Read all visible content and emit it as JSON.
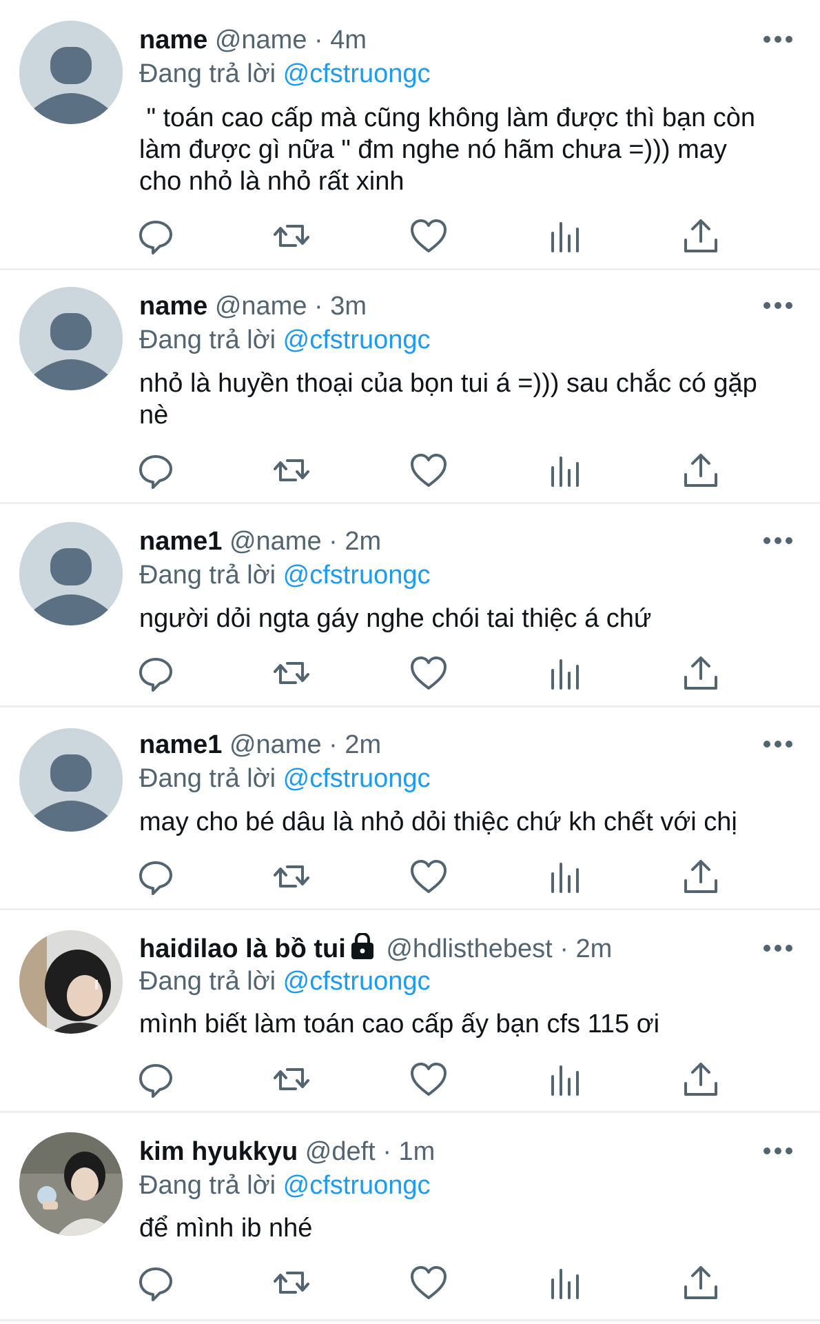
{
  "reply_prefix": "Đang trả lời",
  "tweets": [
    {
      "name": "name",
      "handle": "@name",
      "sep": "·",
      "time": "4m",
      "reply_to": "@cfstruongc",
      "text": " \" toán cao cấp mà cũng không làm được thì bạn còn\nlàm được gì nữa \" đm nghe nó hãm chưa =))) may\ncho nhỏ là nhỏ rất xinh",
      "avatar": "default-avatar",
      "protected": false
    },
    {
      "name": "name",
      "handle": "@name",
      "sep": "·",
      "time": "3m",
      "reply_to": "@cfstruongc",
      "text": "nhỏ là huyền thoại của bọn tui á =))) sau chắc có gặp\nnè",
      "avatar": "default-avatar",
      "protected": false
    },
    {
      "name": "name1",
      "handle": "@name",
      "sep": "·",
      "time": "2m",
      "reply_to": "@cfstruongc",
      "text": "người dỏi ngta gáy nghe chói tai thiệc á chứ",
      "avatar": "default-avatar",
      "protected": false
    },
    {
      "name": "name1",
      "handle": "@name",
      "sep": "·",
      "time": "2m",
      "reply_to": "@cfstruongc",
      "text": "may cho bé dâu là nhỏ dỏi thiệc chứ kh chết với chị",
      "avatar": "default-avatar",
      "protected": false
    },
    {
      "name": "haidilao là bồ tui",
      "handle": "@hdlisthebest",
      "sep": "·",
      "time": "2m",
      "reply_to": "@cfstruongc",
      "text": "mình biết làm toán cao cấp ấy bạn cfs 115 ơi",
      "avatar": "photo-avatar",
      "protected": true
    },
    {
      "name": "kim hyukkyu",
      "handle": "@deft",
      "sep": "·",
      "time": "1m",
      "reply_to": "@cfstruongc",
      "text": "để mình ib nhé",
      "avatar": "photo-avatar",
      "protected": false
    }
  ],
  "icons": {
    "reply": "reply-icon",
    "retweet": "retweet-icon",
    "like": "heart-icon",
    "views": "views-icon",
    "share": "share-icon",
    "more": "more-icon",
    "lock": "lock-icon"
  },
  "colors": {
    "text": "#0f1419",
    "secondary": "#536471",
    "mention": "#1d9bf0",
    "divider": "#eceef0",
    "avatar_bg": "#ccd6dd",
    "avatar_fg": "#5b7083"
  }
}
